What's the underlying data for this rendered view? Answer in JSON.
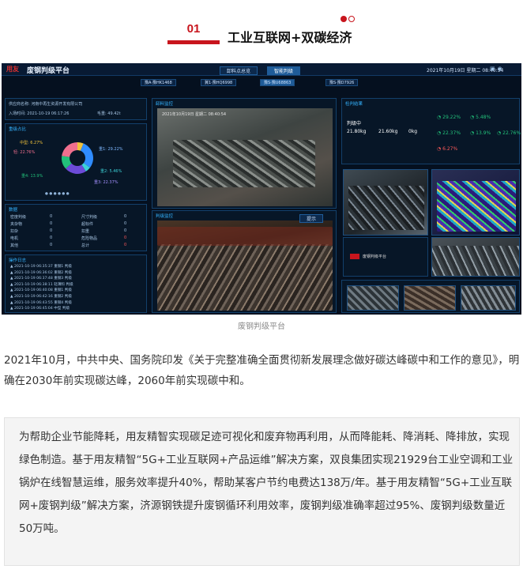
{
  "header": {
    "number": "01",
    "title": "工业互联网+双碳经济"
  },
  "dashboard": {
    "logo": "用友",
    "app_title": "废钢判级平台",
    "tabs": [
      "卸料点总览",
      "智能判级"
    ],
    "datetime": "2021年10月19日 星期二 08:40:54",
    "vehicles": [
      "豫A·豫HK1468",
      "冀1·豫HQ6998",
      "豫S·豫U68863",
      "豫S·豫D7926"
    ],
    "supplier_label": "供应商名称: 河南中再生资源开发有限公司",
    "entry_time": "入场时间: 2021-10-19 06:17:26",
    "gross_weight": "毛重: 49.42t",
    "panel_titles": {
      "distribution": "重级占比",
      "camera1": "卸料监控",
      "camera2": "判级监控",
      "results": "检判结果",
      "stats": "数据",
      "log": "操作日志"
    },
    "donut_legend": [
      {
        "label": "中型: 6.27%",
        "color": "#f0c23b",
        "value": 6.27
      },
      {
        "label": "重1: 29.22%",
        "color": "#2f8cff",
        "value": 29.22
      },
      {
        "label": "重2: 5.46%",
        "color": "#3cd1d6",
        "value": 5.46
      },
      {
        "label": "重3: 22.37%",
        "color": "#6c4bd8",
        "value": 22.37
      },
      {
        "label": "重4: 13.9%",
        "color": "#22c07a",
        "value": 13.9
      },
      {
        "label": "轻: 22.76%",
        "color": "#f06f8e",
        "value": 22.76
      }
    ],
    "result_values": [
      {
        "label": "判级中",
        "value": "21.80kg"
      },
      {
        "label": "",
        "value": "21.60kg"
      },
      {
        "label": "",
        "value": "0kg"
      }
    ],
    "result_percents": [
      "29.22%",
      "5.48%",
      "22.37%",
      "13.9%",
      "22.76%",
      "6.27%"
    ],
    "stats_rows": [
      [
        "密度判级",
        "0",
        "尺寸判级",
        "0"
      ],
      [
        "夹杂物",
        "0",
        "超标件",
        "0"
      ],
      [
        "扣杂",
        "0",
        "扣重",
        "0"
      ],
      [
        "电机",
        "0",
        "危险物品",
        "0"
      ],
      [
        "其他",
        "0",
        "总计",
        "0"
      ]
    ],
    "log_rows": [
      "2021-10-19 06:35:37 重钢1 判级",
      "2021-10-19 06:36:02 重钢2 判级",
      "2021-10-19 06:37:48 重钢3 判级",
      "2021-10-19 06:38:11 轻薄料 判级",
      "2021-10-19 06:40:08 重钢1 判级",
      "2021-10-19 06:42:16 重钢2 判级",
      "2021-10-19 06:43:55 重钢4 判级",
      "2021-10-19 06:45:04 中型 判级"
    ],
    "cam_overlay": "2021年10月19日 星期二 08:40:54",
    "right_brand": "废钢判级平台",
    "alert_btn": "提示"
  },
  "caption": "废钢判级平台",
  "paragraph1": "2021年10月，中共中央、国务院印发《关于完整准确全面贯彻新发展理念做好碳达峰碳中和工作的意见》，明确在2030年前实现碳达峰，2060年前实现碳中和。",
  "paragraph2": "为帮助企业节能降耗，用友精智实现碳足迹可视化和废弃物再利用，从而降能耗、降消耗、降排放，实现绿色制造。基于用友精智“5G+工业互联网+产品运维”解决方案，双良集团实现21929台工业空调和工业锅炉在线智慧运维，服务效率提升40%，帮助某客户节约电费达138万/年。基于用友精智“5G+工业互联网+废钢判级”解决方案，济源钢铁提升废钢循环利用效率，废钢判级准确率超过95%、废钢判级数量近50万吨。"
}
